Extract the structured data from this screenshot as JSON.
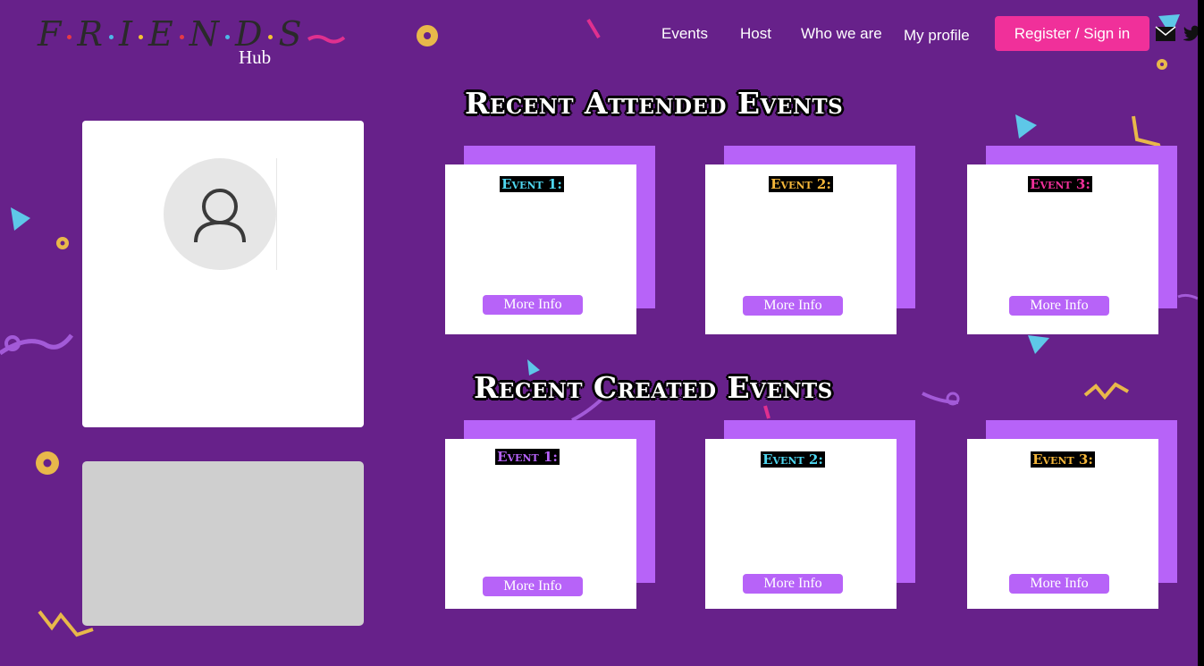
{
  "brand": {
    "wordmark_letters": [
      "F",
      "R",
      "I",
      "E",
      "N",
      "D",
      "S"
    ],
    "sub": "Hub",
    "dot_colors": [
      "#e63946",
      "#4db8e8",
      "#f4c430",
      "#e63946",
      "#4db8e8",
      "#f4c430"
    ]
  },
  "nav": {
    "events": "Events",
    "host": "Host",
    "who": "Who we are",
    "profile": "My profile",
    "register": "Register / Sign in"
  },
  "sections": {
    "attended": {
      "title": "Recent Attended Events",
      "events": [
        {
          "label": "Event 1:",
          "color": "#4fd7f0",
          "button": "More Info"
        },
        {
          "label": "Event 2:",
          "color": "#f5b73a",
          "button": "More Info"
        },
        {
          "label": "Event 3:",
          "color": "#f0309a",
          "button": "More Info"
        }
      ]
    },
    "created": {
      "title": "Recent Created Events",
      "events": [
        {
          "label": "Event 1:",
          "color": "#b763f8",
          "button": "More Info"
        },
        {
          "label": "Event 2:",
          "color": "#4fd7f0",
          "button": "More Info"
        },
        {
          "label": "Event 3:",
          "color": "#f5b73a",
          "button": "More Info"
        }
      ]
    }
  },
  "colors": {
    "background": "#67218a",
    "accent": "#f0309a",
    "card_shadow": "#b763f8"
  },
  "icons": {
    "avatar": "user-icon",
    "mail": "mail-icon",
    "twitter": "twitter-icon"
  }
}
